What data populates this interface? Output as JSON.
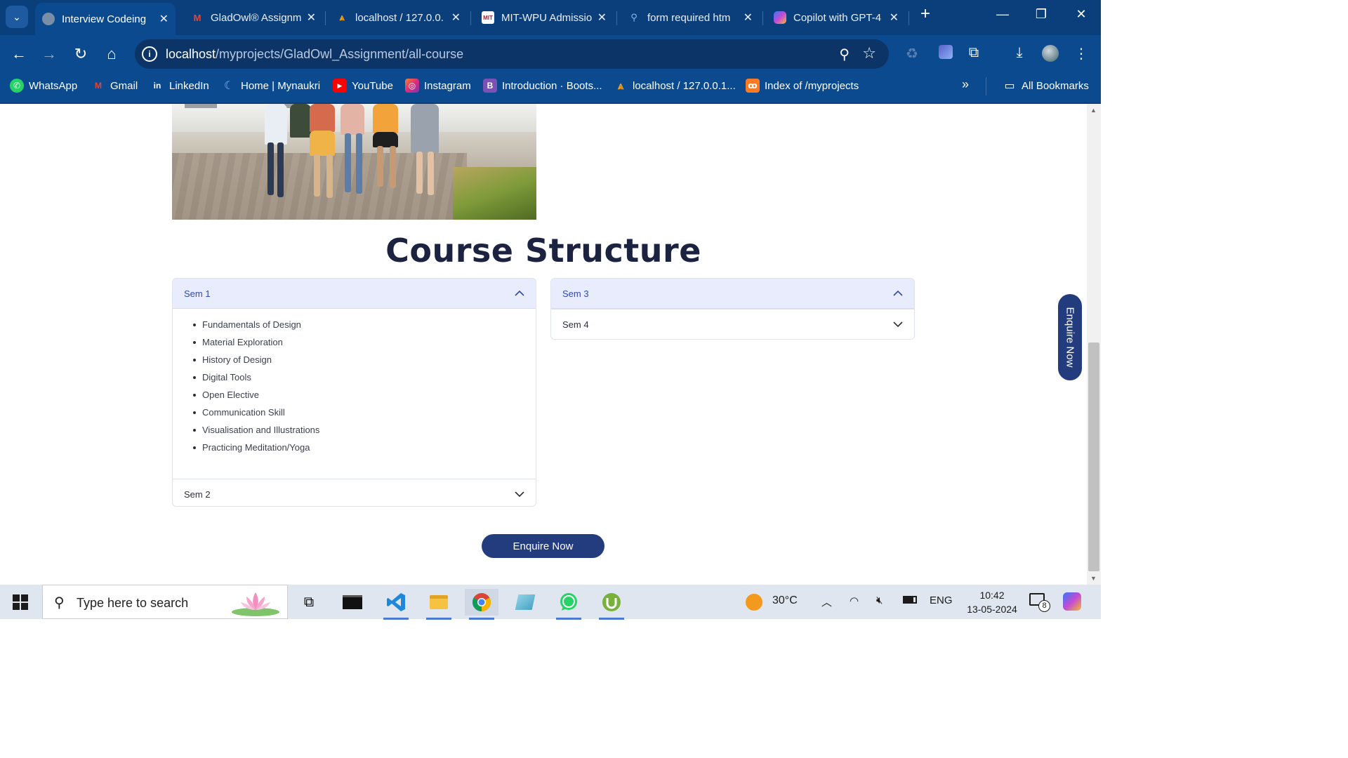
{
  "browser": {
    "tabs": [
      {
        "title": "Interview Codeing",
        "active": true,
        "icon": "globe-icon"
      },
      {
        "title": "GladOwl® Assignm",
        "active": false,
        "icon": "gmail-icon"
      },
      {
        "title": "localhost / 127.0.0.",
        "active": false,
        "icon": "phpmyadmin-icon"
      },
      {
        "title": "MIT-WPU Admissio",
        "active": false,
        "icon": "mitwpu-icon"
      },
      {
        "title": "form required htm",
        "active": false,
        "icon": "search-icon"
      },
      {
        "title": "Copilot with GPT-4",
        "active": false,
        "icon": "copilot-icon"
      }
    ],
    "new_tab": "+",
    "url_host": "localhost",
    "url_path": "/myprojects/GladOwl_Assignment/all-course",
    "bookmarks": [
      {
        "label": "WhatsApp",
        "icon": "whatsapp-icon",
        "color": "#25d366"
      },
      {
        "label": "Gmail",
        "icon": "gmail-icon",
        "color": "#ea4335"
      },
      {
        "label": "LinkedIn",
        "icon": "linkedin-icon",
        "color": "#0a66c2"
      },
      {
        "label": "Home | Mynaukri",
        "icon": "mynaukri-icon",
        "color": "#4a90e2"
      },
      {
        "label": "YouTube",
        "icon": "youtube-icon",
        "color": "#ff0000"
      },
      {
        "label": "Instagram",
        "icon": "instagram-icon",
        "color": "#d6249f"
      },
      {
        "label": "Introduction · Boots...",
        "icon": "bootstrap-icon",
        "color": "#7952b3"
      },
      {
        "label": "localhost / 127.0.0.1...",
        "icon": "phpmyadmin-icon",
        "color": "#f89c0e"
      },
      {
        "label": "Index of /myprojects",
        "icon": "xampp-icon",
        "color": "#fb7a24"
      }
    ],
    "more_bookmarks": "»",
    "all_bookmarks": "All Bookmarks"
  },
  "page": {
    "title": "Course Structure",
    "enquire_button": "Enquire Now",
    "enquire_side": "Enquire Now",
    "left_accordion": [
      {
        "label": "Sem 1",
        "open": true,
        "items": [
          "Fundamentals of Design",
          "Material Exploration",
          "History of Design",
          "Digital Tools",
          "Open Elective",
          "Communication Skill",
          "Visualisation and Illustrations",
          "Practicing Meditation/Yoga"
        ]
      },
      {
        "label": "Sem 2",
        "open": false,
        "items": []
      }
    ],
    "right_accordion": [
      {
        "label": "Sem 3",
        "open": true,
        "items": []
      },
      {
        "label": "Sem 4",
        "open": false,
        "items": []
      }
    ]
  },
  "taskbar": {
    "search_placeholder": "Type here to search",
    "weather": "30°C",
    "language": "ENG",
    "time": "10:42",
    "date": "13-05-2024",
    "notification_count": "8",
    "apps": [
      "task-view-icon",
      "terminal-icon",
      "vscode-icon",
      "file-explorer-icon",
      "chrome-icon",
      "notepad-icon",
      "whatsapp-icon",
      "utorrent-icon"
    ]
  },
  "colors": {
    "chrome_bg": "#0b4a8f",
    "accent_navy": "#233c7e",
    "open_header_bg": "#e9ecfc",
    "title_text": "#1b2340"
  }
}
